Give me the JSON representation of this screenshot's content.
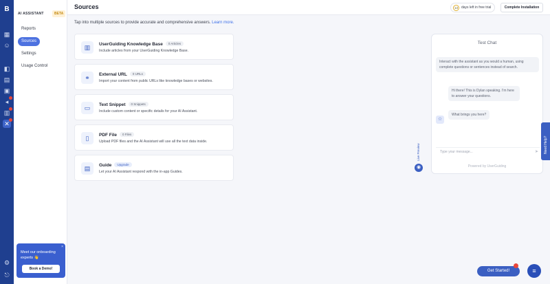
{
  "rail": {
    "logo": "B",
    "icons": [
      "grid-icon",
      "user-icon",
      "layers-icon",
      "book-icon",
      "message-icon",
      "megaphone-icon",
      "report-icon",
      "ai-icon",
      "settings-icon",
      "logout-icon"
    ]
  },
  "nav": {
    "heading": "AI ASSISTANT",
    "beta": "BETA",
    "items": [
      {
        "label": "Reports"
      },
      {
        "label": "Sources"
      },
      {
        "label": "Settings"
      },
      {
        "label": "Usage Control"
      }
    ]
  },
  "onboarding": {
    "text": "Meet our onboarding experts 👋",
    "button": "Book a Demo!",
    "close": "×"
  },
  "header": {
    "title": "Sources",
    "trial_days": "13",
    "trial_text": "days left in free trial",
    "complete_label": "Complete Installation"
  },
  "intro": {
    "text": "Tap into multiple sources to provide accurate and comprehensive answers.",
    "link": "Learn more."
  },
  "sources": [
    {
      "name": "UserGuiding Knowledge Base",
      "badge": "0 Articles",
      "desc": "Include articles from your UserGuiding Knowledge Base.",
      "icon": "book-icon"
    },
    {
      "name": "External URL",
      "badge": "0 URLs",
      "desc": "Import your content from public URLs like knowledge bases or websites.",
      "icon": "link-icon"
    },
    {
      "name": "Text Snippet",
      "badge": "0 Snippets",
      "desc": "Include custom content or specific details for your AI Assistant.",
      "icon": "text-icon"
    },
    {
      "name": "PDF File",
      "badge": "0 Files",
      "desc": "Upload PDF files and the AI Assistant will use all the text data inside.",
      "icon": "file-icon"
    },
    {
      "name": "Guide",
      "badge": "Upgrade",
      "desc": "Let your AI Assistant respond with the in-app Guides.",
      "icon": "guide-icon"
    }
  ],
  "live_preview": "Live Preview",
  "chat": {
    "title": "Test Chat",
    "tip": "Interact with the assistant as you would a human, using complete questions or sentences instead of search.",
    "greeting": "Hi there! This is Dylan speaking. I'm here to answer your questions.",
    "question": "What brings you here?",
    "placeholder": "Type your message...",
    "powered": "Powered by UserGuiding"
  },
  "help": "Need Help?",
  "get_started": "Get Started!"
}
